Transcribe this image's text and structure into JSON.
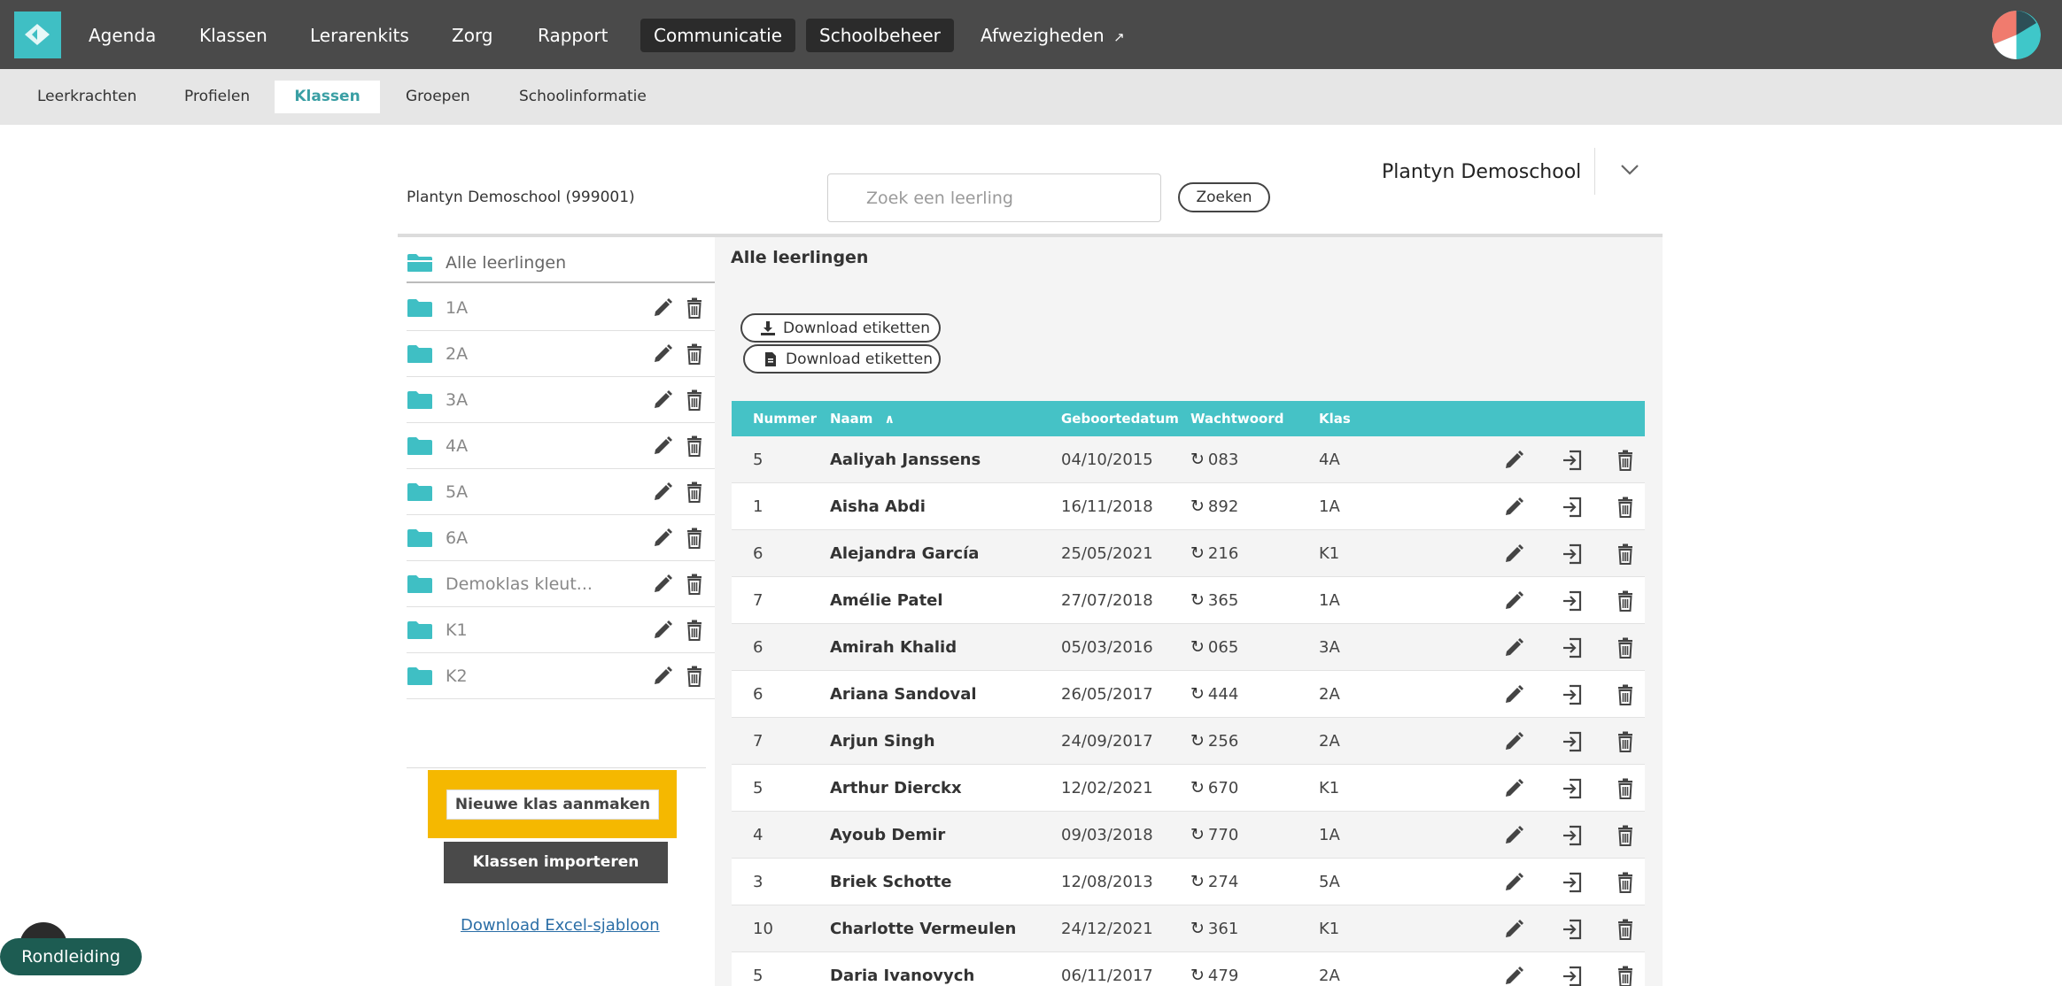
{
  "nav": {
    "items": [
      {
        "label": "Agenda"
      },
      {
        "label": "Klassen"
      },
      {
        "label": "Lerarenkits"
      },
      {
        "label": "Zorg"
      },
      {
        "label": "Rapport"
      },
      {
        "label": "Communicatie"
      },
      {
        "label": "Schoolbeheer"
      },
      {
        "label": "Afwezigheden"
      }
    ]
  },
  "subnav": {
    "items": [
      {
        "label": "Leerkrachten"
      },
      {
        "label": "Profielen"
      },
      {
        "label": "Klassen"
      },
      {
        "label": "Groepen"
      },
      {
        "label": "Schoolinformatie"
      }
    ]
  },
  "header": {
    "school_id": "Plantyn Demoschool (999001)",
    "search_placeholder": "Zoek een leerling",
    "search_button": "Zoeken",
    "school_name": "Plantyn Demoschool"
  },
  "sidebar": {
    "all_label": "Alle leerlingen",
    "classes": [
      "1A",
      "2A",
      "3A",
      "4A",
      "5A",
      "6A",
      "Demoklas kleut...",
      "K1",
      "K2"
    ],
    "new_class_button": "Nieuwe klas aanmaken",
    "import_button": "Klassen importeren",
    "excel_link": "Download Excel-sjabloon"
  },
  "main": {
    "title": "Alle leerlingen",
    "download_label_1": "Download etiketten",
    "download_label_2": "Download etiketten",
    "columns": {
      "number": "Nummer",
      "name": "Naam",
      "birthdate": "Geboortedatum",
      "password": "Wachtwoord",
      "class": "Klas"
    },
    "rows": [
      {
        "number": "5",
        "name": "Aaliyah Janssens",
        "birthdate": "04/10/2015",
        "password": "083",
        "class": "4A"
      },
      {
        "number": "1",
        "name": "Aisha Abdi",
        "birthdate": "16/11/2018",
        "password": "892",
        "class": "1A"
      },
      {
        "number": "6",
        "name": "Alejandra García",
        "birthdate": "25/05/2021",
        "password": "216",
        "class": "K1"
      },
      {
        "number": "7",
        "name": "Amélie Patel",
        "birthdate": "27/07/2018",
        "password": "365",
        "class": "1A"
      },
      {
        "number": "6",
        "name": "Amirah Khalid",
        "birthdate": "05/03/2016",
        "password": "065",
        "class": "3A"
      },
      {
        "number": "6",
        "name": "Ariana Sandoval",
        "birthdate": "26/05/2017",
        "password": "444",
        "class": "2A"
      },
      {
        "number": "7",
        "name": "Arjun Singh",
        "birthdate": "24/09/2017",
        "password": "256",
        "class": "2A"
      },
      {
        "number": "5",
        "name": "Arthur Dierckx",
        "birthdate": "12/02/2021",
        "password": "670",
        "class": "K1"
      },
      {
        "number": "4",
        "name": "Ayoub Demir",
        "birthdate": "09/03/2018",
        "password": "770",
        "class": "1A"
      },
      {
        "number": "3",
        "name": "Briek Schotte",
        "birthdate": "12/08/2013",
        "password": "274",
        "class": "5A"
      },
      {
        "number": "10",
        "name": "Charlotte Vermeulen",
        "birthdate": "24/12/2021",
        "password": "361",
        "class": "K1"
      },
      {
        "number": "5",
        "name": "Daria Ivanovych",
        "birthdate": "06/11/2017",
        "password": "479",
        "class": "2A"
      }
    ]
  },
  "tour": {
    "label": "Rondleiding"
  },
  "colors": {
    "accent": "#45c2c6",
    "topbar": "#4a4a4a",
    "highlight": "#f5b800",
    "tour": "#1d5c52"
  }
}
